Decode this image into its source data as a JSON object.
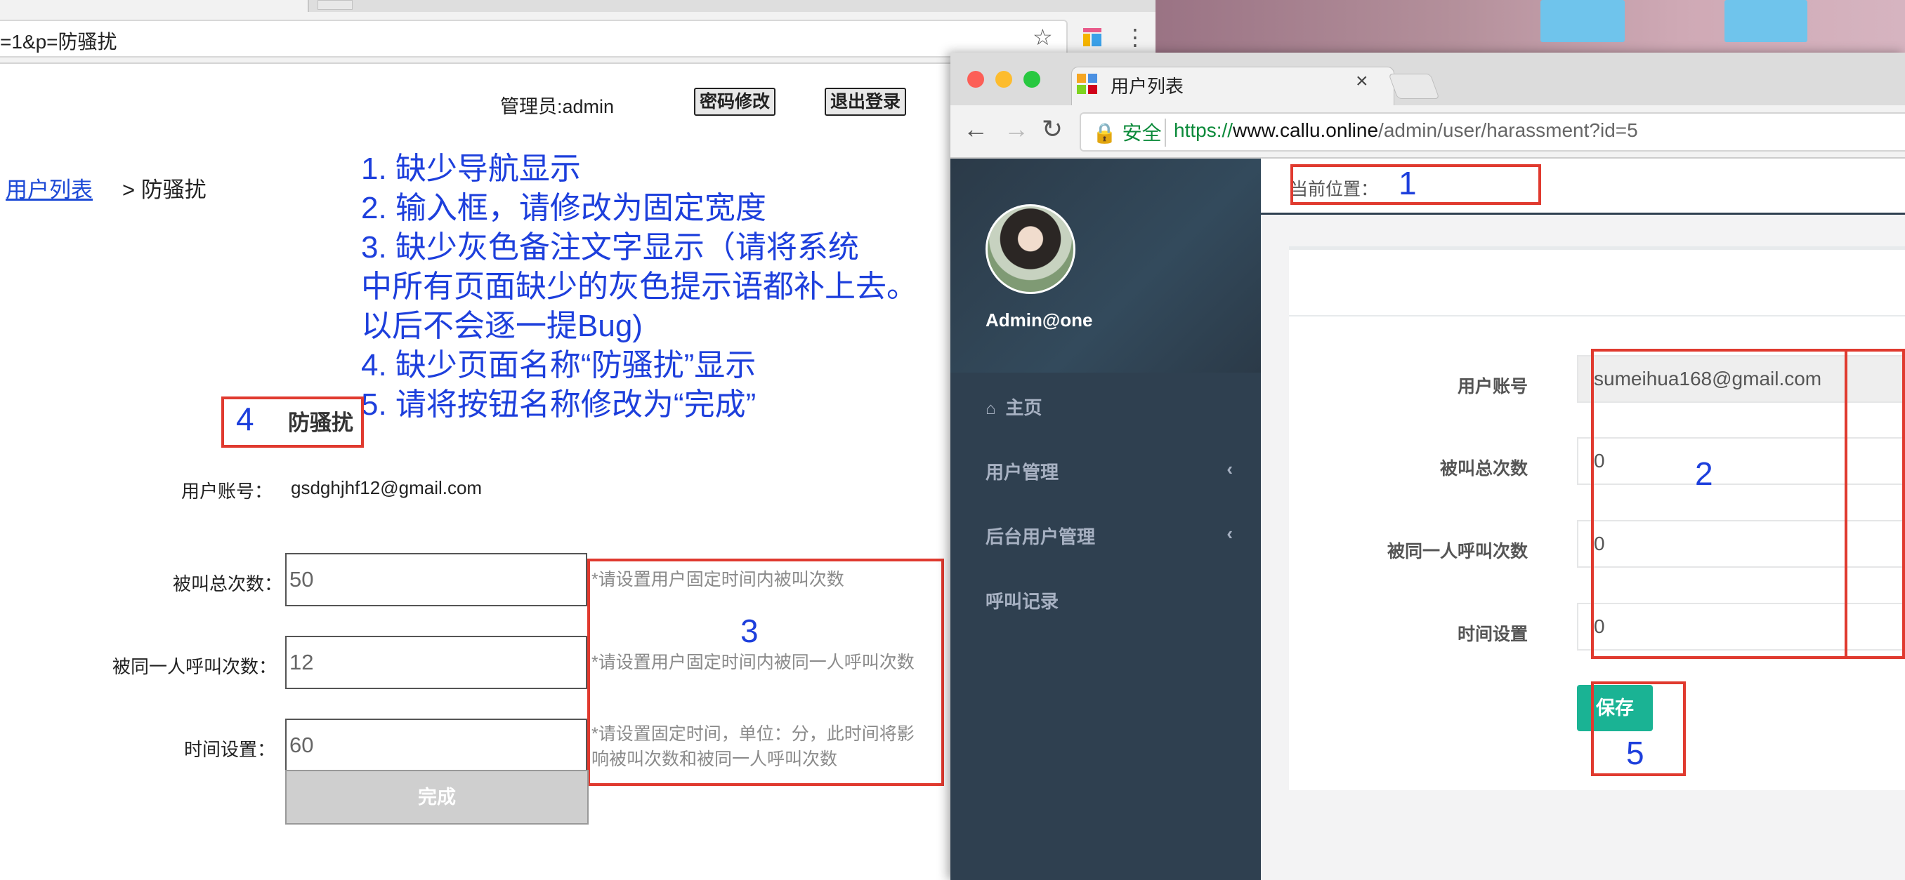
{
  "left": {
    "url": "=1&p=防骚扰",
    "admin_label": "管理员:admin",
    "change_password": "密码修改",
    "logout": "退出登录",
    "breadcrumb": {
      "link": "用户列表",
      "current": "> 防骚扰"
    },
    "notes": [
      "1. 缺少导航显示",
      "2. 输入框，请修改为固定宽度",
      "3. 缺少灰色备注文字显示（请将系统",
      "中所有页面缺少的灰色提示语都补上去。",
      "以后不会逐一提Bug)",
      "4. 缺少页面名称“防骚扰”显示",
      "5. 请将按钮名称修改为“完成”"
    ],
    "annotation_4": "4",
    "annotation_3": "3",
    "page_title": "防骚扰",
    "account_label": "用户账号：",
    "account_value": "gsdghjhf12@gmail.com",
    "fields": [
      {
        "label": "被叫总次数：",
        "value": "50",
        "hint": "*请设置用户固定时间内被叫次数"
      },
      {
        "label": "被同一人呼叫次数：",
        "value": "12",
        "hint": "*请设置用户固定时间内被同一人呼叫次数"
      },
      {
        "label": "时间设置：",
        "value": "60",
        "hint_line1": "*请设置固定时间，单位：分，此时间将影",
        "hint_line2": "响被叫次数和被同一人呼叫次数"
      }
    ],
    "done_button": "完成"
  },
  "right": {
    "tab_title": "用户列表",
    "tab_close": "×",
    "secure_label": "安全",
    "url": {
      "scheme": "https://",
      "host": "www.callu.online",
      "path": "/admin/user/harassment?id=5"
    },
    "user_name": "Admin@one",
    "sidebar_items": [
      {
        "label": "主页",
        "icon": "home-icon"
      },
      {
        "label": "用户管理",
        "chevron": "‹"
      },
      {
        "label": "后台用户管理",
        "chevron": "‹"
      },
      {
        "label": "呼叫记录"
      }
    ],
    "crumb_label": "当前位置：",
    "annotation_1": "1",
    "annotation_2": "2",
    "annotation_5": "5",
    "form": [
      {
        "label": "用户账号",
        "value": "sumeihua168@gmail.com",
        "readonly": true
      },
      {
        "label": "被叫总次数",
        "value": "0"
      },
      {
        "label": "被同一人呼叫次数",
        "value": "0"
      },
      {
        "label": "时间设置",
        "value": "0"
      }
    ],
    "save_button": "保存"
  },
  "colors": {
    "annotation_blue": "#1d3fdc",
    "annotation_red": "#e03a2f",
    "sidebar_bg": "#2f4050",
    "save_green": "#1ab394",
    "link_blue": "#1d4ad6",
    "hint_gray": "#8a8a8a"
  }
}
